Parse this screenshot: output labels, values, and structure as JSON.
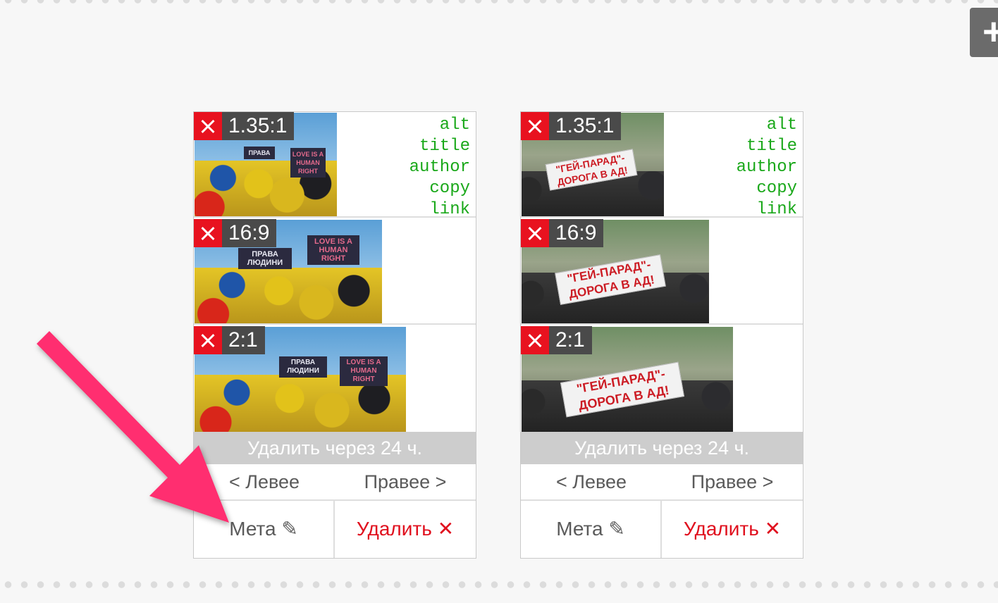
{
  "toolbar": {
    "add_label": "+"
  },
  "cards": [
    {
      "crops": [
        {
          "ratio": "1.35:1"
        },
        {
          "ratio": "16:9"
        },
        {
          "ratio": "2:1"
        }
      ],
      "meta_links": [
        "alt",
        "title",
        "author",
        "copy",
        "link"
      ],
      "signs": {
        "prava_top": "ПРАВА",
        "prava": "ПРАВА ЛЮДИНИ",
        "love": "LOVE IS A HUMAN RIGHT"
      },
      "expire_text": "Удалить через 24 ч.",
      "nav_left": "< Левее",
      "nav_right": "Правее >",
      "meta_button": "Мета ✎",
      "delete_button": "Удалить ✕"
    },
    {
      "crops": [
        {
          "ratio": "1.35:1"
        },
        {
          "ratio": "16:9"
        },
        {
          "ratio": "2:1"
        }
      ],
      "meta_links": [
        "alt",
        "title",
        "author",
        "copy",
        "link"
      ],
      "signs": {
        "banner_line1": "\"ГЕЙ-ПАРАД\"-",
        "banner_line2": "ДОРОГА В АД!"
      },
      "expire_text": "Удалить через 24 ч.",
      "nav_left": "< Левее",
      "nav_right": "Правее >",
      "meta_button": "Мета ✎",
      "delete_button": "Удалить ✕"
    }
  ],
  "annotation": {
    "arrow_color": "#ff2d6f"
  }
}
